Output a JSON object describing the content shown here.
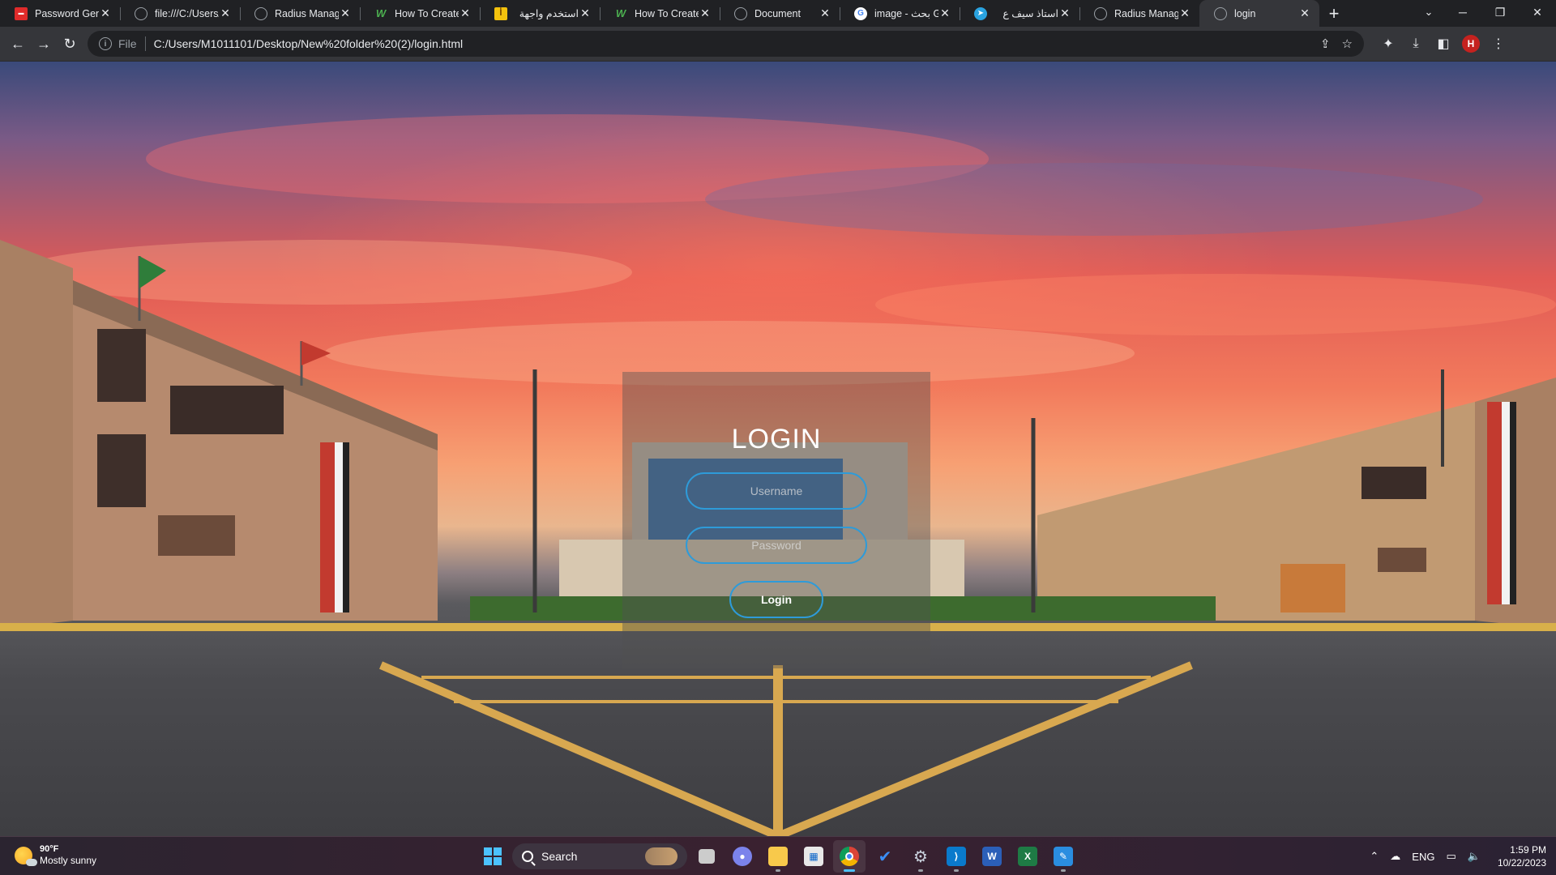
{
  "browser": {
    "tabs": [
      {
        "title": "Password Gene",
        "favicon": "red-square-icon",
        "active": false
      },
      {
        "title": "file:///C:/Users/",
        "favicon": "globe-icon",
        "active": false
      },
      {
        "title": "Radius Manage",
        "favicon": "globe-icon",
        "active": false
      },
      {
        "title": "How To Create",
        "favicon": "w3schools-icon",
        "active": false
      },
      {
        "title": "استخدم واجهة",
        "favicon": "yellow-site-icon",
        "active": false
      },
      {
        "title": "How To Create",
        "favicon": "w3schools-icon",
        "active": false
      },
      {
        "title": "Document",
        "favicon": "globe-icon",
        "active": false
      },
      {
        "title": "image - بحث G",
        "favicon": "google-icon",
        "active": false
      },
      {
        "title": "استاذ سيف ع",
        "favicon": "telegram-icon",
        "active": false
      },
      {
        "title": "Radius Manage",
        "favicon": "globe-icon",
        "active": false
      },
      {
        "title": "login",
        "favicon": "globe-icon",
        "active": true
      }
    ],
    "new_tab_label": "+",
    "address": {
      "scheme_label": "File",
      "url": "C:/Users/M1011101/Desktop/New%20folder%20(2)/login.html"
    },
    "profile_initial": "H"
  },
  "login": {
    "title": "LOGIN",
    "username_placeholder": "Username",
    "password_placeholder": "Password",
    "button_label": "Login"
  },
  "taskbar": {
    "weather": {
      "temp": "90°F",
      "condition": "Mostly sunny"
    },
    "search_label": "Search",
    "tray": {
      "language": "ENG",
      "time": "1:59 PM",
      "date": "10/22/2023"
    }
  }
}
